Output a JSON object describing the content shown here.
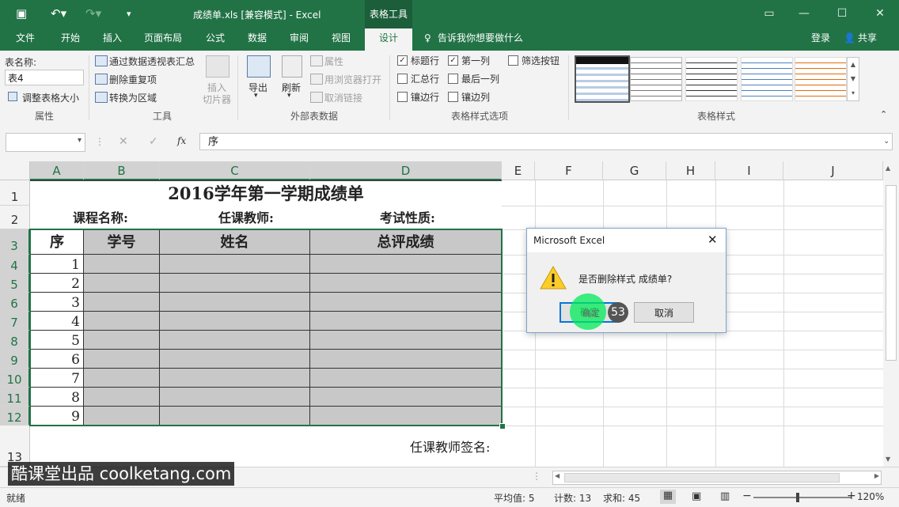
{
  "title_bar": {
    "doc_title": "成绩单.xls  [兼容模式] - Excel",
    "context_tab": "表格工具"
  },
  "tabs": [
    "文件",
    "开始",
    "插入",
    "页面布局",
    "公式",
    "数据",
    "审阅",
    "视图",
    "设计"
  ],
  "tell_me": "告诉我你想要做什么",
  "account": {
    "login": "登录",
    "share": "共享"
  },
  "ribbon": {
    "properties": {
      "table_name_label": "表名称:",
      "table_name_value": "表4",
      "resize": "调整表格大小",
      "group": "属性"
    },
    "tools": {
      "pivot": "通过数据透视表汇总",
      "remove_dup": "删除重复项",
      "convert": "转换为区域",
      "slicer_line1": "插入",
      "slicer_line2": "切片器",
      "group": "工具"
    },
    "external": {
      "export": "导出",
      "refresh": "刷新",
      "properties": "属性",
      "open_browser": "用浏览器打开",
      "unlink": "取消链接",
      "group": "外部表数据"
    },
    "style_options": {
      "header_row": "标题行",
      "first_col": "第一列",
      "filter_btn": "筛选按钮",
      "total_row": "汇总行",
      "last_col": "最后一列",
      "banded_rows": "镶边行",
      "banded_cols": "镶边列",
      "group": "表格样式选项"
    },
    "styles": {
      "group": "表格样式"
    }
  },
  "formula_bar": {
    "content": "序",
    "fx": "fx"
  },
  "columns": [
    "A",
    "B",
    "C",
    "D",
    "E",
    "F",
    "G",
    "H",
    "I",
    "J"
  ],
  "rows": [
    "1",
    "2",
    "3",
    "4",
    "5",
    "6",
    "7",
    "8",
    "9",
    "10",
    "11",
    "12",
    "13"
  ],
  "sheet": {
    "title": "2016学年第一学期成绩单",
    "course_label": "课程名称:",
    "teacher_label": "任课教师:",
    "exam_label": "考试性质:",
    "headers": [
      "序",
      "学号",
      "姓名",
      "总评成绩"
    ],
    "seq": [
      "1",
      "2",
      "3",
      "4",
      "5",
      "6",
      "7",
      "8",
      "9"
    ],
    "signature": "任课教师签名:"
  },
  "dialog": {
    "title": "Microsoft Excel",
    "message": "是否删除样式 成绩单?",
    "ok": "确定",
    "cancel": "取消",
    "step_badge": "53"
  },
  "status": {
    "ready": "就绪",
    "average": "平均值: 5",
    "count": "计数: 13",
    "sum": "求和: 45",
    "zoom": "120%"
  },
  "watermark": "酷课堂出品 coolketang.com"
}
